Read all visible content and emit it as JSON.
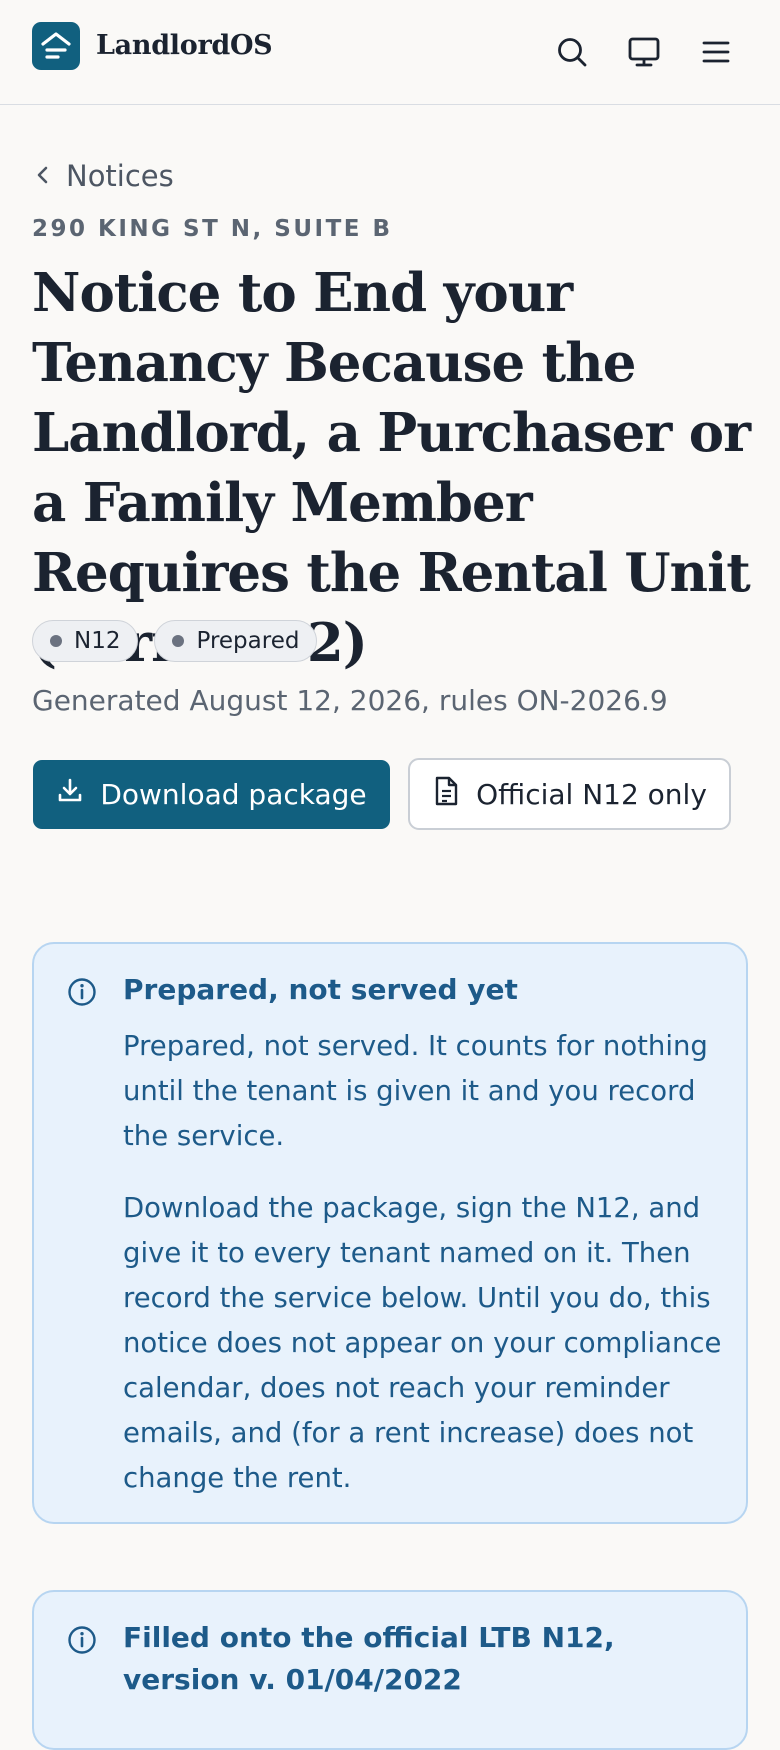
{
  "app": {
    "name": "LandlordOS"
  },
  "header": {
    "icons": [
      "search-icon",
      "monitor-icon",
      "menu-icon"
    ]
  },
  "breadcrumb": {
    "back_label": "Notices"
  },
  "notice": {
    "address": "290 KING ST N, SUITE B",
    "title": "Notice to End your Tenancy Because the Landlord, a Purchaser or a Family Member Requires the Rental Unit (Form N12)",
    "badges": [
      "N12",
      "Prepared"
    ],
    "generated": "Generated August 12, 2026, rules ON-2026.9"
  },
  "actions": {
    "download_label": "Download package",
    "official_label": "Official N12 only"
  },
  "alerts": [
    {
      "title": "Prepared, not served yet",
      "paragraphs": [
        "Prepared, not served. It counts for nothing until the tenant is given it and you record the service.",
        "Download the package, sign the N12, and give it to every tenant named on it. Then record the service below. Until you do, this notice does not appear on your compliance calendar, does not reach your reminder emails, and (for a rent increase) does not change the rent."
      ]
    },
    {
      "title": "Filled onto the official LTB N12, version v. 01/04/2022"
    }
  ],
  "colors": {
    "accent": "#11607f",
    "info_text": "#1d5a89",
    "info_bg": "#e8f2fc"
  }
}
